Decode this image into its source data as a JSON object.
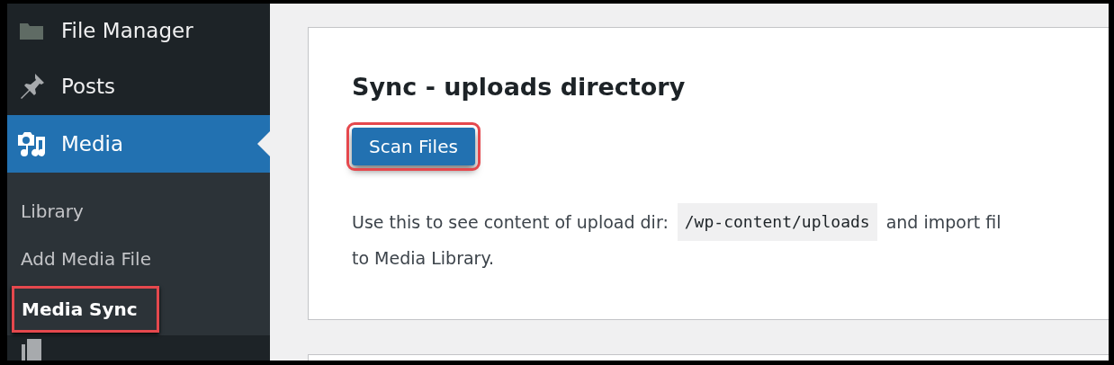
{
  "sidebar": {
    "items": [
      {
        "label": "File Manager",
        "kind": "folder",
        "selected": false
      },
      {
        "label": "Posts",
        "kind": "pin",
        "selected": false
      },
      {
        "label": "Media",
        "kind": "media",
        "selected": true,
        "children": [
          {
            "label": "Library",
            "selected": false,
            "highlighted": false
          },
          {
            "label": "Add Media File",
            "selected": false,
            "highlighted": false
          },
          {
            "label": "Media Sync",
            "selected": true,
            "highlighted": true
          }
        ]
      },
      {
        "kind": "pages",
        "selected": false
      }
    ]
  },
  "card": {
    "title": "Sync - uploads directory",
    "button": {
      "label": "Scan Files",
      "highlighted": true
    },
    "description": {
      "before": "Use this to see content of upload dir:",
      "code": "/wp-content/uploads",
      "after": "and import fil",
      "line2": "to Media Library."
    }
  }
}
